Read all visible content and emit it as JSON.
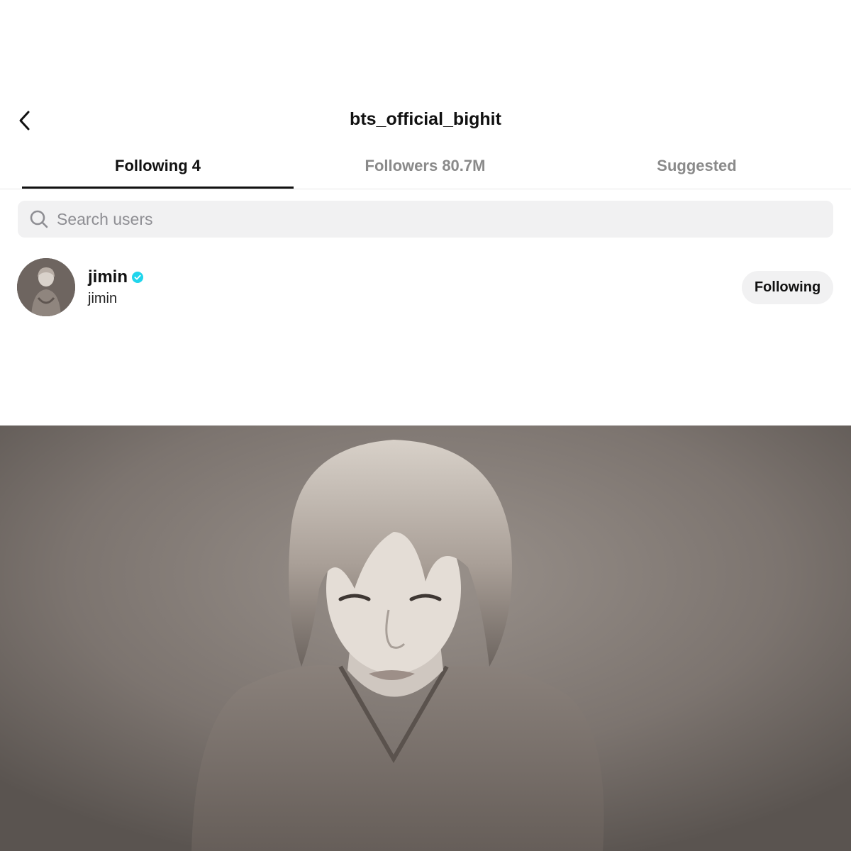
{
  "header": {
    "title": "bts_official_bighit",
    "back_icon": "chevron-left-icon"
  },
  "tabs": [
    {
      "label": "Following 4",
      "active": true
    },
    {
      "label": "Followers 80.7M",
      "active": false
    },
    {
      "label": "Suggested",
      "active": false
    }
  ],
  "search": {
    "placeholder": "Search users",
    "value": "",
    "icon": "search-icon"
  },
  "users": [
    {
      "username": "jimin",
      "display_name": "jimin",
      "verified": true,
      "button_label": "Following"
    }
  ],
  "colors": {
    "verified": "#20d5ec",
    "tab_active": "#111111",
    "tab_inactive": "#8a8a8a",
    "search_bg": "#f1f1f2"
  }
}
